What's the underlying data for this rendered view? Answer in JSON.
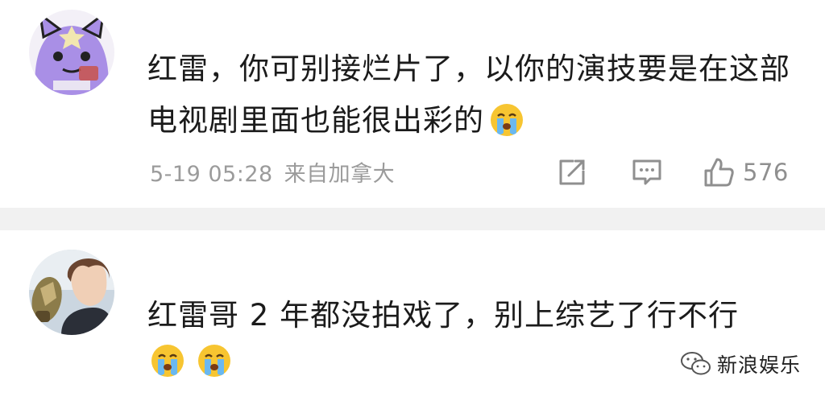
{
  "comments": [
    {
      "text": "红雷，你可别接烂片了，以你的演技要是在这部电视剧里面也能很出彩的",
      "emojis": [
        "crying-face"
      ],
      "date": "5-19 05:28",
      "location": "来自加拿大",
      "likes": "576"
    },
    {
      "text": "红雷哥 2 年都没拍戏了，别上综艺了行不行",
      "emojis": [
        "crying-face",
        "crying-face"
      ]
    }
  ],
  "watermark": {
    "text": "新浪娱乐"
  },
  "colors": {
    "separator": "#f1f1f1",
    "meta_text": "#9b9b9b",
    "avatar_purple": "#a98fe6"
  }
}
